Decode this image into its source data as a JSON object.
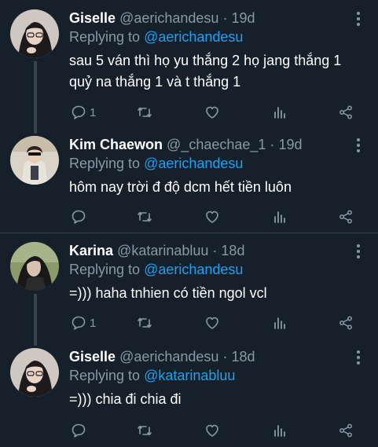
{
  "tweets": [
    {
      "name": "Giselle",
      "handle": "@aerichandesu",
      "separator": "·",
      "time": "19d",
      "replying_label": "Replying to",
      "replying_to": "@aerichandesu",
      "text": "sau 5 ván thì họ yu thắng 2 họ jang thắng 1 quỷ na thắng 1 và t thắng 1",
      "reply_count": "1",
      "avatar": "avatar-giselle"
    },
    {
      "name": "Kim Chaewon",
      "handle": "@_chaechae_1",
      "separator": "·",
      "time": "19d",
      "replying_label": "Replying to",
      "replying_to": "@aerichandesu",
      "text": "hôm nay trời đ độ dcm hết tiền luôn",
      "reply_count": "",
      "avatar": "avatar-chaewon"
    },
    {
      "name": "Karina",
      "handle": "@katarinabluu",
      "separator": "·",
      "time": "18d",
      "replying_label": "Replying to",
      "replying_to": "@aerichandesu",
      "text": "=))) haha tnhien có tiền ngol vcl",
      "reply_count": "1",
      "avatar": "avatar-karina"
    },
    {
      "name": "Giselle",
      "handle": "@aerichandesu",
      "separator": "·",
      "time": "18d",
      "replying_label": "Replying to",
      "replying_to": "@katarinabluu",
      "text": "=))) chia đi chia đi",
      "reply_count": "",
      "avatar": "avatar-giselle"
    }
  ],
  "icons": {
    "reply": "comment-icon",
    "retweet": "retweet-icon",
    "like": "heart-icon",
    "analytics": "analytics-icon",
    "share": "share-icon",
    "more": "more-vertical-icon"
  },
  "colors": {
    "background": "#15202b",
    "secondary_text": "#8899a6",
    "link": "#1da1f2",
    "divider": "#38444d"
  }
}
